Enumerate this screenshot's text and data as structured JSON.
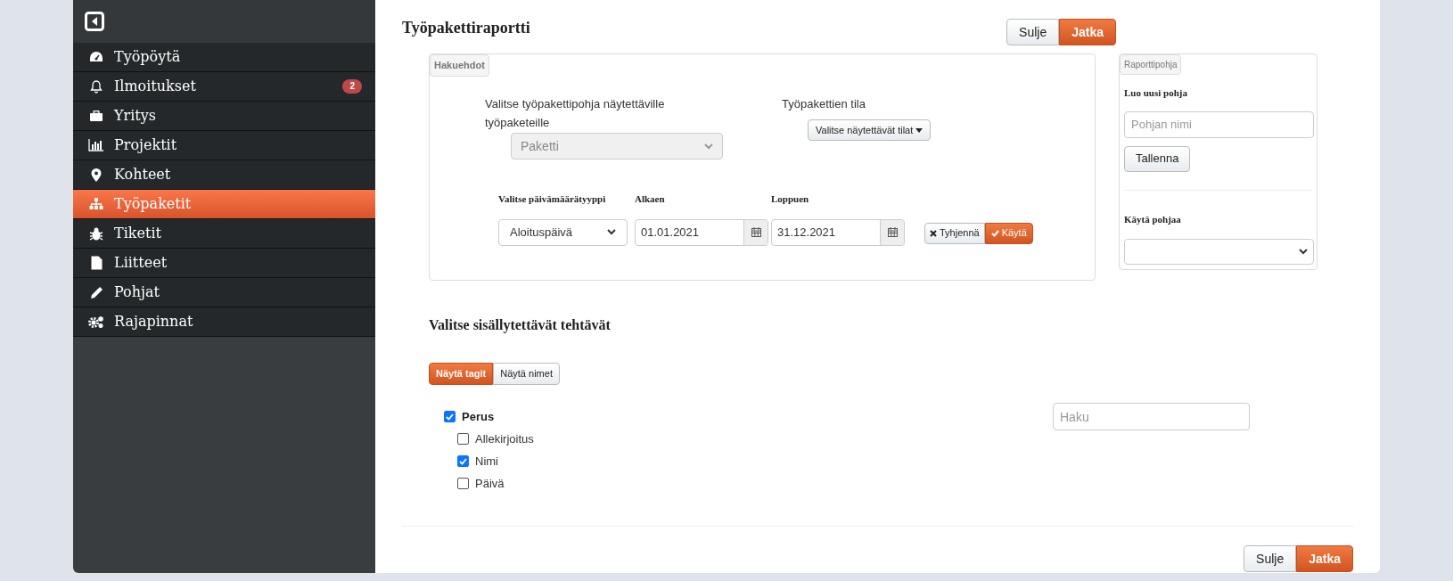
{
  "sidebar": {
    "items": [
      {
        "label": "Työpöytä",
        "selected": false
      },
      {
        "label": "Ilmoitukset",
        "selected": false,
        "badge": "2"
      },
      {
        "label": "Yritys",
        "selected": false
      },
      {
        "label": "Projektit",
        "selected": false
      },
      {
        "label": "Kohteet",
        "selected": false
      },
      {
        "label": "Työpaketit",
        "selected": true
      },
      {
        "label": "Tiketit",
        "selected": false
      },
      {
        "label": "Liitteet",
        "selected": false
      },
      {
        "label": "Pohjat",
        "selected": false
      },
      {
        "label": "Rajapinnat",
        "selected": false
      }
    ]
  },
  "title": "Työpakettiraportti",
  "top_buttons": [
    "Sulje",
    "Jatka"
  ],
  "search_criteria": {
    "legend": "Hakuehdot",
    "template_label": "Valitse työpakettipohja näytettäville työpaketeille",
    "template_select": {
      "value": "Paketti",
      "disabled": true
    },
    "status_label": "Työpakettien tila",
    "status_button": "Valitse näytettävät tilat",
    "date_type_label": "Valitse päivämäärätyyppi",
    "date_type_value": "Aloituspäivä",
    "start_label": "Alkaen",
    "start_value": "01.01.2021",
    "end_label": "Loppuen",
    "end_value": "31.12.2021",
    "clear_button": "Tyhjennä",
    "apply_button": "Käytä"
  },
  "report_template": {
    "legend": "Raporttipohja",
    "new_label": "Luo uusi pohja",
    "name_placeholder": "Pohjan nimi",
    "save_button": "Tallenna",
    "use_label": "Käytä pohjaa"
  },
  "tasks_heading": "Valitse sisällytettävät tehtävät",
  "view_tabs": [
    {
      "label": "Näytä tagit",
      "selected": true
    },
    {
      "label": "Näytä nimet",
      "selected": false
    }
  ],
  "tasks": [
    {
      "label": "Perus",
      "checked": true,
      "children": [
        {
          "label": "Allekirjoitus",
          "checked": false
        },
        {
          "label": "Nimi",
          "checked": true
        },
        {
          "label": "Päivä",
          "checked": false
        }
      ]
    }
  ],
  "search": {
    "placeholder": "Haku"
  },
  "bottom_buttons": [
    "Sulje",
    "Jatka"
  ]
}
